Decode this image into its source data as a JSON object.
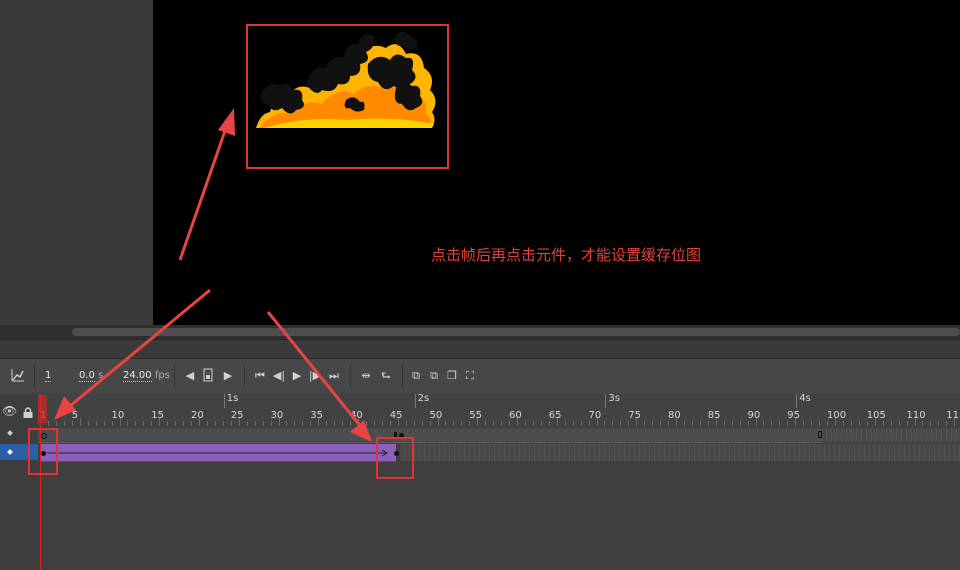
{
  "annotation": {
    "text": "点击帧后再点击元件，才能设置缓存位图",
    "color": "#e0433a"
  },
  "toolbar": {
    "frame": "1",
    "time_value": "0.0",
    "time_unit": "s",
    "fps_value": "24.00",
    "fps_unit": "fps",
    "icons": [
      "graph-icon",
      "prev-frame-icon",
      "frame-center-icon",
      "next-frame-icon",
      "first-frame-icon",
      "step-back-icon",
      "play-icon",
      "step-forward-icon",
      "last-frame-icon",
      "loop-icon",
      "sync-icon",
      "onion-skin-icon",
      "onion-outline-icon",
      "edit-multiple-icon",
      "onion-range-icon"
    ]
  },
  "timeline": {
    "seconds": [
      "1s",
      "2s",
      "3s",
      "4s"
    ],
    "frame_numbers": [
      "1",
      "5",
      "10",
      "15",
      "20",
      "25",
      "30",
      "35",
      "40",
      "45",
      "50",
      "55",
      "60",
      "65",
      "70",
      "75",
      "80",
      "85",
      "90",
      "95",
      "100",
      "105",
      "110",
      "11"
    ],
    "layer_header_icons": [
      "eye-icon",
      "lock-icon"
    ]
  },
  "colors": {
    "tween": "#8e5ebd",
    "highlight": "#e03434",
    "stage": "#000000",
    "playhead": "#dd2222"
  }
}
